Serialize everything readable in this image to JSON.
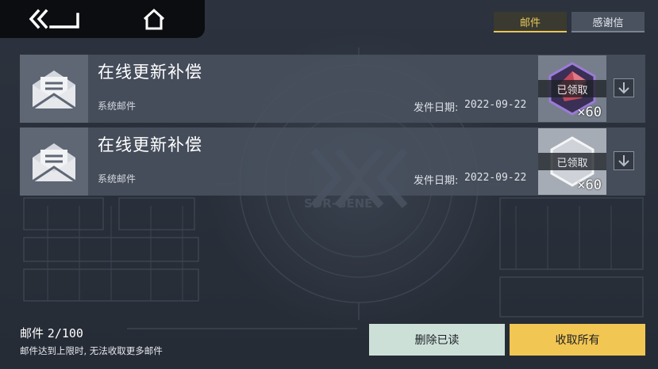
{
  "nav": {
    "back_icon": "double-chevron-back-icon",
    "home_icon": "home-icon"
  },
  "tabs": [
    {
      "label": "邮件",
      "active": true
    },
    {
      "label": "感谢信",
      "active": false
    }
  ],
  "mails": [
    {
      "title": "在线更新补偿",
      "type": "系统邮件",
      "date_label": "发件日期:",
      "date": "2022-09-22",
      "reward_status": "已领取",
      "reward_count": "×60",
      "reward_icon": "purple-hexagon-crystal-icon"
    },
    {
      "title": "在线更新补偿",
      "type": "系统邮件",
      "date_label": "发件日期:",
      "date": "2022-09-22",
      "reward_status": "已领取",
      "reward_count": "×60",
      "reward_icon": "white-hexagon-icon"
    }
  ],
  "footer": {
    "mail_label": "邮件",
    "mail_count": "2/100",
    "limit_notice": "邮件达到上限时, 无法收取更多邮件",
    "delete_read_label": "删除已读",
    "collect_all_label": "收取所有"
  },
  "background_logo": "SDR-GENE",
  "colors": {
    "accent_yellow": "#f2c652",
    "delete_button": "#cde0d8",
    "nav_bg": "#0b0d10"
  }
}
